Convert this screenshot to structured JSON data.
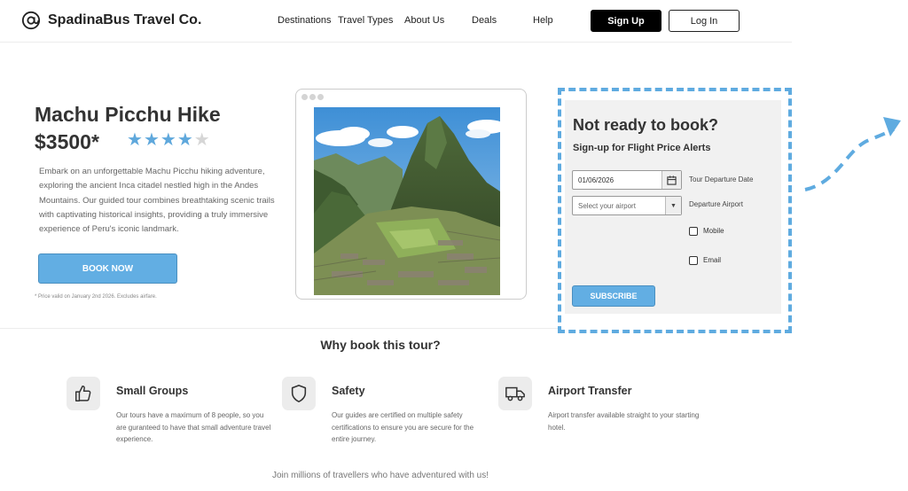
{
  "brand": {
    "name": "SpadinaBus Travel Co."
  },
  "nav": {
    "items": [
      "Destinations",
      "Travel Types",
      "About Us",
      "Deals",
      "Help"
    ],
    "signup_label": "Sign Up",
    "login_label": "Log In"
  },
  "hero": {
    "title": "Machu Picchu Hike",
    "price": "$3500*",
    "rating": {
      "value": 4,
      "max": 5
    },
    "description": "Embark on an unforgettable Machu Picchu hiking adventure, exploring the ancient Inca citadel nestled high in the Andes Mountains. Our guided tour combines breathtaking scenic trails with captivating historical insights, providing a truly immersive experience of Peru's iconic landmark.",
    "book_label": "BOOK NOW",
    "price_note": "* Price valid on January 2nd 2026. Excludes airfare."
  },
  "signup_panel": {
    "title": "Not ready to book?",
    "subtitle": "Sign-up for Flight Price Alerts",
    "date_value": "01/06/2026",
    "date_label": "Tour Departure Date",
    "airport_placeholder": "Select your airport",
    "airport_label": "Departure Airport",
    "mobile_label": "Mobile",
    "email_label": "Email",
    "subscribe_label": "SUBSCRIBE"
  },
  "why": {
    "title": "Why book this tour?",
    "features": [
      {
        "icon": "thumbs-up-icon",
        "title": "Small Groups",
        "text": "Our tours have a maximum of 8 people, so you are guranteed to have that small adventure travel experience."
      },
      {
        "icon": "shield-icon",
        "title": "Safety",
        "text": "Our guides are certified on multiple safety certifications to ensure you are secure for the entire journey."
      },
      {
        "icon": "truck-icon",
        "title": "Airport Transfer",
        "text": "Airport transfer available straight to your starting hotel."
      }
    ]
  },
  "footer": {
    "text": "Join millions of travellers who have adventured with us!"
  },
  "colors": {
    "accent": "#62aee3",
    "star_filled": "#5fa8dc",
    "star_empty": "#d6d6d6"
  }
}
